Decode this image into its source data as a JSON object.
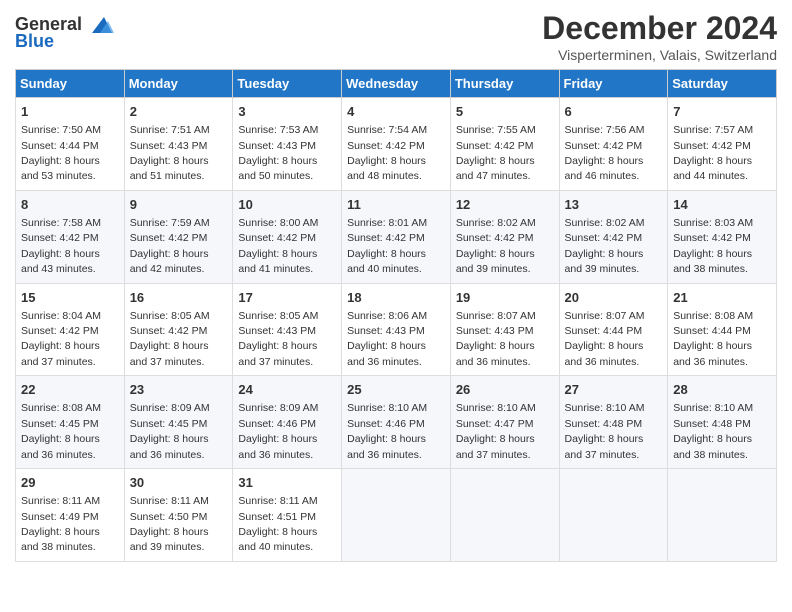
{
  "logo": {
    "general": "General",
    "blue": "Blue"
  },
  "title": "December 2024",
  "subtitle": "Visperterminen, Valais, Switzerland",
  "weekdays": [
    "Sunday",
    "Monday",
    "Tuesday",
    "Wednesday",
    "Thursday",
    "Friday",
    "Saturday"
  ],
  "weeks": [
    [
      {
        "day": "1",
        "sunrise": "Sunrise: 7:50 AM",
        "sunset": "Sunset: 4:44 PM",
        "daylight": "Daylight: 8 hours and 53 minutes."
      },
      {
        "day": "2",
        "sunrise": "Sunrise: 7:51 AM",
        "sunset": "Sunset: 4:43 PM",
        "daylight": "Daylight: 8 hours and 51 minutes."
      },
      {
        "day": "3",
        "sunrise": "Sunrise: 7:53 AM",
        "sunset": "Sunset: 4:43 PM",
        "daylight": "Daylight: 8 hours and 50 minutes."
      },
      {
        "day": "4",
        "sunrise": "Sunrise: 7:54 AM",
        "sunset": "Sunset: 4:42 PM",
        "daylight": "Daylight: 8 hours and 48 minutes."
      },
      {
        "day": "5",
        "sunrise": "Sunrise: 7:55 AM",
        "sunset": "Sunset: 4:42 PM",
        "daylight": "Daylight: 8 hours and 47 minutes."
      },
      {
        "day": "6",
        "sunrise": "Sunrise: 7:56 AM",
        "sunset": "Sunset: 4:42 PM",
        "daylight": "Daylight: 8 hours and 46 minutes."
      },
      {
        "day": "7",
        "sunrise": "Sunrise: 7:57 AM",
        "sunset": "Sunset: 4:42 PM",
        "daylight": "Daylight: 8 hours and 44 minutes."
      }
    ],
    [
      {
        "day": "8",
        "sunrise": "Sunrise: 7:58 AM",
        "sunset": "Sunset: 4:42 PM",
        "daylight": "Daylight: 8 hours and 43 minutes."
      },
      {
        "day": "9",
        "sunrise": "Sunrise: 7:59 AM",
        "sunset": "Sunset: 4:42 PM",
        "daylight": "Daylight: 8 hours and 42 minutes."
      },
      {
        "day": "10",
        "sunrise": "Sunrise: 8:00 AM",
        "sunset": "Sunset: 4:42 PM",
        "daylight": "Daylight: 8 hours and 41 minutes."
      },
      {
        "day": "11",
        "sunrise": "Sunrise: 8:01 AM",
        "sunset": "Sunset: 4:42 PM",
        "daylight": "Daylight: 8 hours and 40 minutes."
      },
      {
        "day": "12",
        "sunrise": "Sunrise: 8:02 AM",
        "sunset": "Sunset: 4:42 PM",
        "daylight": "Daylight: 8 hours and 39 minutes."
      },
      {
        "day": "13",
        "sunrise": "Sunrise: 8:02 AM",
        "sunset": "Sunset: 4:42 PM",
        "daylight": "Daylight: 8 hours and 39 minutes."
      },
      {
        "day": "14",
        "sunrise": "Sunrise: 8:03 AM",
        "sunset": "Sunset: 4:42 PM",
        "daylight": "Daylight: 8 hours and 38 minutes."
      }
    ],
    [
      {
        "day": "15",
        "sunrise": "Sunrise: 8:04 AM",
        "sunset": "Sunset: 4:42 PM",
        "daylight": "Daylight: 8 hours and 37 minutes."
      },
      {
        "day": "16",
        "sunrise": "Sunrise: 8:05 AM",
        "sunset": "Sunset: 4:42 PM",
        "daylight": "Daylight: 8 hours and 37 minutes."
      },
      {
        "day": "17",
        "sunrise": "Sunrise: 8:05 AM",
        "sunset": "Sunset: 4:43 PM",
        "daylight": "Daylight: 8 hours and 37 minutes."
      },
      {
        "day": "18",
        "sunrise": "Sunrise: 8:06 AM",
        "sunset": "Sunset: 4:43 PM",
        "daylight": "Daylight: 8 hours and 36 minutes."
      },
      {
        "day": "19",
        "sunrise": "Sunrise: 8:07 AM",
        "sunset": "Sunset: 4:43 PM",
        "daylight": "Daylight: 8 hours and 36 minutes."
      },
      {
        "day": "20",
        "sunrise": "Sunrise: 8:07 AM",
        "sunset": "Sunset: 4:44 PM",
        "daylight": "Daylight: 8 hours and 36 minutes."
      },
      {
        "day": "21",
        "sunrise": "Sunrise: 8:08 AM",
        "sunset": "Sunset: 4:44 PM",
        "daylight": "Daylight: 8 hours and 36 minutes."
      }
    ],
    [
      {
        "day": "22",
        "sunrise": "Sunrise: 8:08 AM",
        "sunset": "Sunset: 4:45 PM",
        "daylight": "Daylight: 8 hours and 36 minutes."
      },
      {
        "day": "23",
        "sunrise": "Sunrise: 8:09 AM",
        "sunset": "Sunset: 4:45 PM",
        "daylight": "Daylight: 8 hours and 36 minutes."
      },
      {
        "day": "24",
        "sunrise": "Sunrise: 8:09 AM",
        "sunset": "Sunset: 4:46 PM",
        "daylight": "Daylight: 8 hours and 36 minutes."
      },
      {
        "day": "25",
        "sunrise": "Sunrise: 8:10 AM",
        "sunset": "Sunset: 4:46 PM",
        "daylight": "Daylight: 8 hours and 36 minutes."
      },
      {
        "day": "26",
        "sunrise": "Sunrise: 8:10 AM",
        "sunset": "Sunset: 4:47 PM",
        "daylight": "Daylight: 8 hours and 37 minutes."
      },
      {
        "day": "27",
        "sunrise": "Sunrise: 8:10 AM",
        "sunset": "Sunset: 4:48 PM",
        "daylight": "Daylight: 8 hours and 37 minutes."
      },
      {
        "day": "28",
        "sunrise": "Sunrise: 8:10 AM",
        "sunset": "Sunset: 4:48 PM",
        "daylight": "Daylight: 8 hours and 38 minutes."
      }
    ],
    [
      {
        "day": "29",
        "sunrise": "Sunrise: 8:11 AM",
        "sunset": "Sunset: 4:49 PM",
        "daylight": "Daylight: 8 hours and 38 minutes."
      },
      {
        "day": "30",
        "sunrise": "Sunrise: 8:11 AM",
        "sunset": "Sunset: 4:50 PM",
        "daylight": "Daylight: 8 hours and 39 minutes."
      },
      {
        "day": "31",
        "sunrise": "Sunrise: 8:11 AM",
        "sunset": "Sunset: 4:51 PM",
        "daylight": "Daylight: 8 hours and 40 minutes."
      },
      null,
      null,
      null,
      null
    ]
  ]
}
